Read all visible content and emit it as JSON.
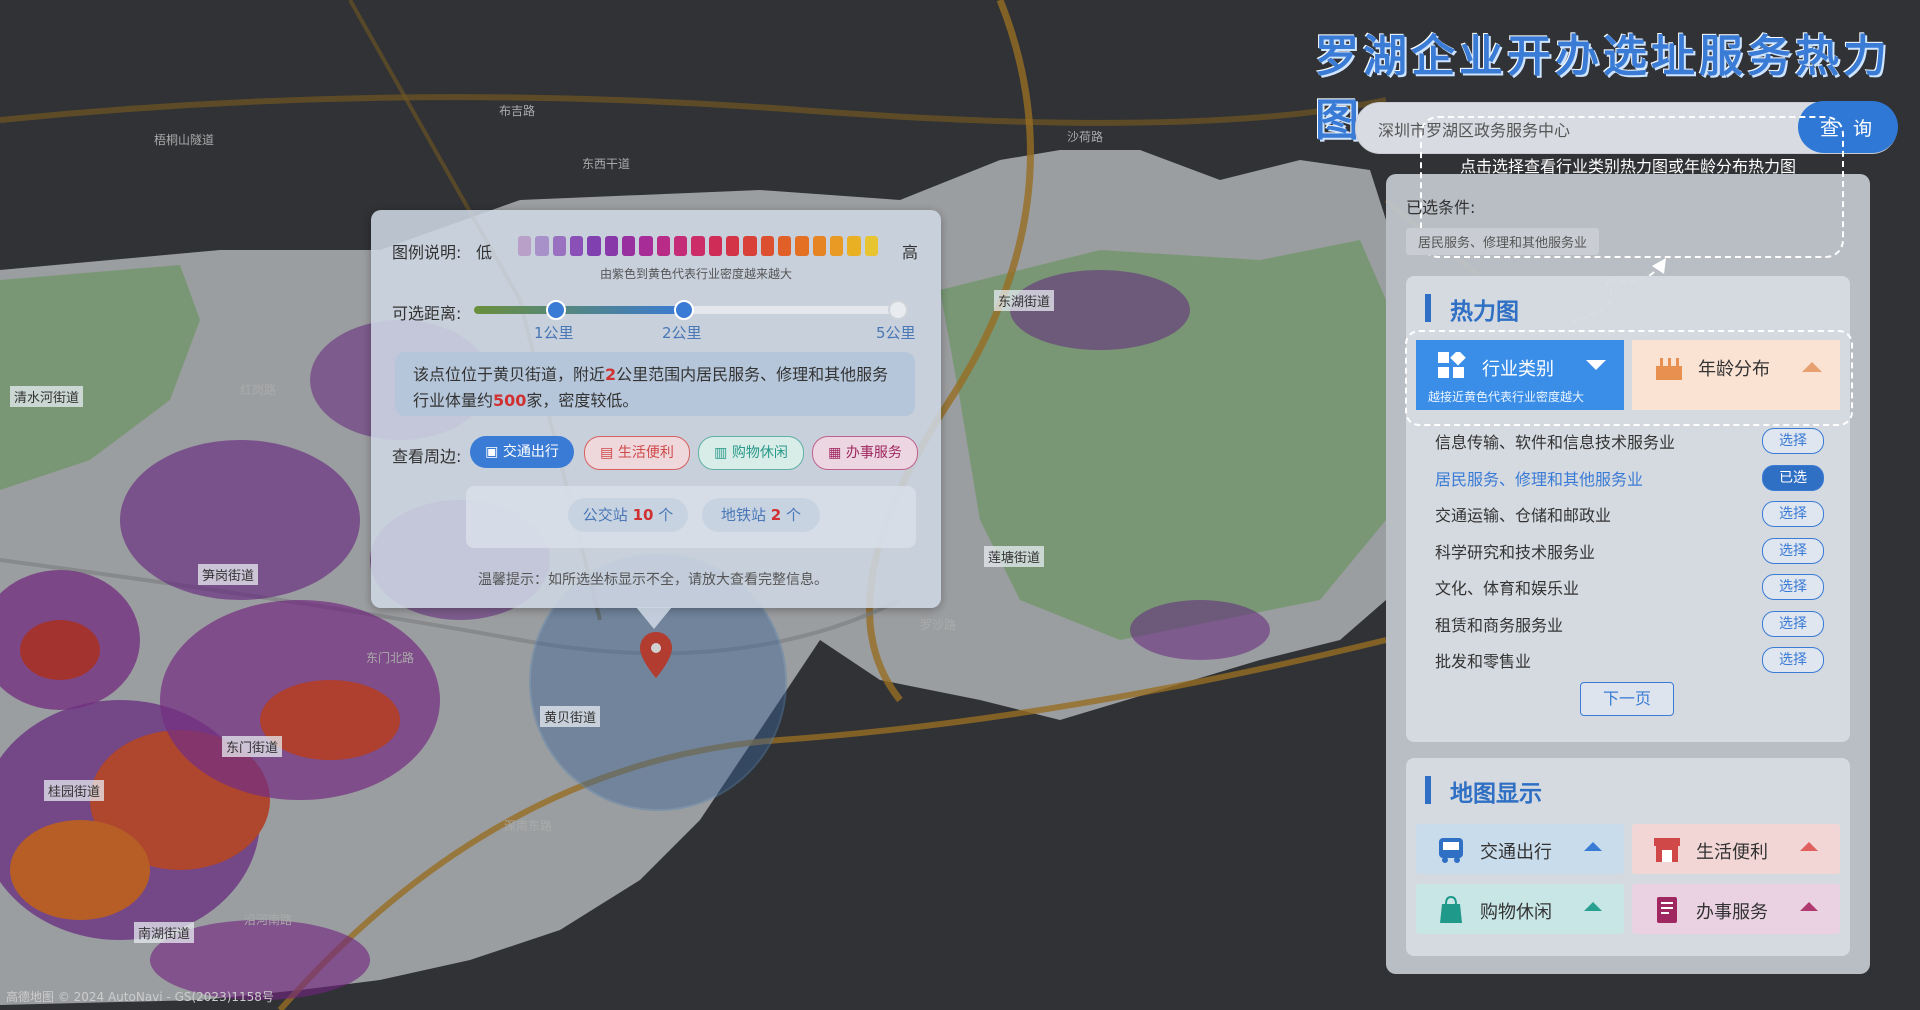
{
  "title": "罗湖企业开办选址服务热力图",
  "search": {
    "value": "深圳市罗湖区政务服务中心",
    "button": "查 询"
  },
  "hint": "点击选择查看行业类别热力图或年龄分布热力图",
  "selected": {
    "label": "已选条件:",
    "tag": "居民服务、修理和其他服务业"
  },
  "heatmap_section": {
    "title": "热力图",
    "tab_industry": {
      "label": "行业类别",
      "sub": "越接近黄色代表行业密度越大",
      "icon": "grid-icon"
    },
    "tab_age": {
      "label": "年龄分布",
      "icon": "cake-icon"
    }
  },
  "industries": [
    {
      "name": "信息传输、软件和信息技术服务业",
      "btn": "选择"
    },
    {
      "name": "居民服务、修理和其他服务业",
      "btn": "已选"
    },
    {
      "name": "交通运输、仓储和邮政业",
      "btn": "选择"
    },
    {
      "name": "科学研究和技术服务业",
      "btn": "选择"
    },
    {
      "name": "文化、体育和娱乐业",
      "btn": "选择"
    },
    {
      "name": "租赁和商务服务业",
      "btn": "选择"
    },
    {
      "name": "批发和零售业",
      "btn": "选择"
    }
  ],
  "next_page": "下一页",
  "map_display": {
    "title": "地图显示",
    "items": [
      {
        "label": "交通出行",
        "icon": "bus-icon"
      },
      {
        "label": "生活便利",
        "icon": "store-icon"
      },
      {
        "label": "购物休闲",
        "icon": "bag-icon"
      },
      {
        "label": "办事服务",
        "icon": "document-icon"
      }
    ]
  },
  "popup": {
    "legend_label": "图例说明:",
    "low": "低",
    "high": "高",
    "legend_note": "由紫色到黄色代表行业密度越来越大",
    "distance_label": "可选距离:",
    "ticks": [
      "1公里",
      "2公里",
      "5公里"
    ],
    "info_part1": "该点位位于黄贝街道，附近",
    "info_num1": "2",
    "info_part2": "公里范围内居民服务、修理和其他服务",
    "info_part3": "行业体量约",
    "info_num2": "500",
    "info_part4": "家，密度较低。",
    "nearby_label": "查看周边:",
    "chips": [
      "交通出行",
      "生活便利",
      "购物休闲",
      "办事服务"
    ],
    "bus_label": "公交站",
    "bus_count": "10",
    "bus_unit": "个",
    "metro_label": "地铁站",
    "metro_count": "2",
    "metro_unit": "个",
    "tip": "温馨提示：如所选坐标显示不全，请放大查看完整信息。"
  },
  "streets": [
    "清水河街道",
    "笋岗街道",
    "东门街道",
    "桂园街道",
    "南湖街道",
    "黄贝街道",
    "东湖街道",
    "莲塘街道"
  ],
  "roads": [
    "布吉路",
    "东西干道",
    "沙荷路",
    "罗沙路",
    "红岗路",
    "东门北路",
    "沿河南路",
    "深南东路",
    "梧桐山隧道"
  ],
  "attribution": "高德地图 © 2024 AutoNavi - GS(2023)1158号",
  "colors": {
    "accent": "#3a7bd5",
    "highlight": "#d03030",
    "heat_low": "#7a2d9a",
    "heat_high": "#e8c020"
  }
}
